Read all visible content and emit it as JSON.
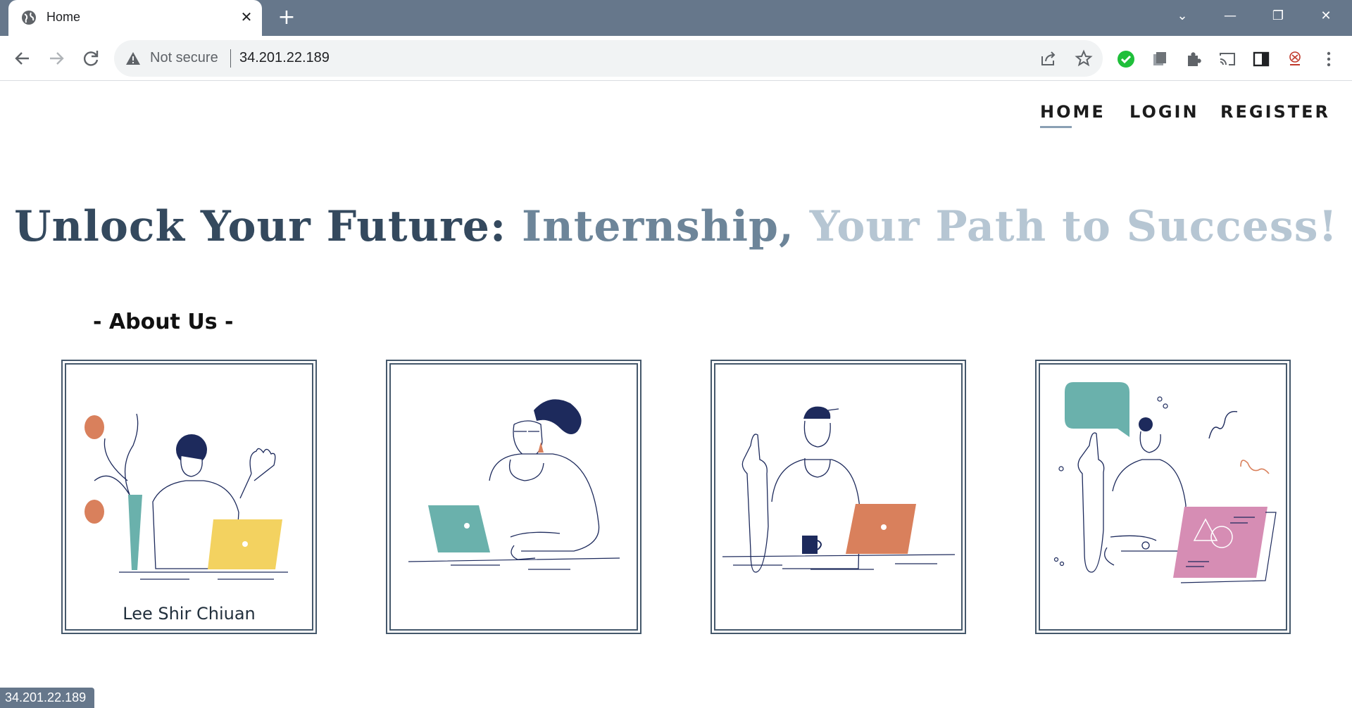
{
  "browser": {
    "tab_title": "Home",
    "tab_close": "✕",
    "new_tab": "+",
    "security_label": "Not secure",
    "url": "34.201.22.189",
    "status_url": "34.201.22.189",
    "window_controls": [
      "⌄",
      "—",
      "❐",
      "✕"
    ]
  },
  "nav": {
    "home": "HOME",
    "login": "LOGIN",
    "register": "REGISTER"
  },
  "hero": {
    "part1": "Unlock Your Future: ",
    "part2": "Internship, ",
    "part3": "Your Path to Success!",
    "colors": [
      "#34495e",
      "#6d8599",
      "#b6c6d3"
    ]
  },
  "about": {
    "heading": "- About Us -",
    "members": [
      {
        "name": "Lee Shir Chiuan",
        "illustration": "person-waving-yellow-laptop"
      },
      {
        "name": "",
        "illustration": "woman-teal-laptop"
      },
      {
        "name": "",
        "illustration": "man-orange-laptop-coffee"
      },
      {
        "name": "",
        "illustration": "woman-pink-screen-speech-bubble"
      }
    ]
  },
  "colors": {
    "tab_bar": "#66778b",
    "accent_teal": "#6ab1ac",
    "accent_yellow": "#f3d260",
    "accent_orange": "#d9805c",
    "accent_pink": "#d68db4",
    "ink": "#1d2a5c"
  }
}
